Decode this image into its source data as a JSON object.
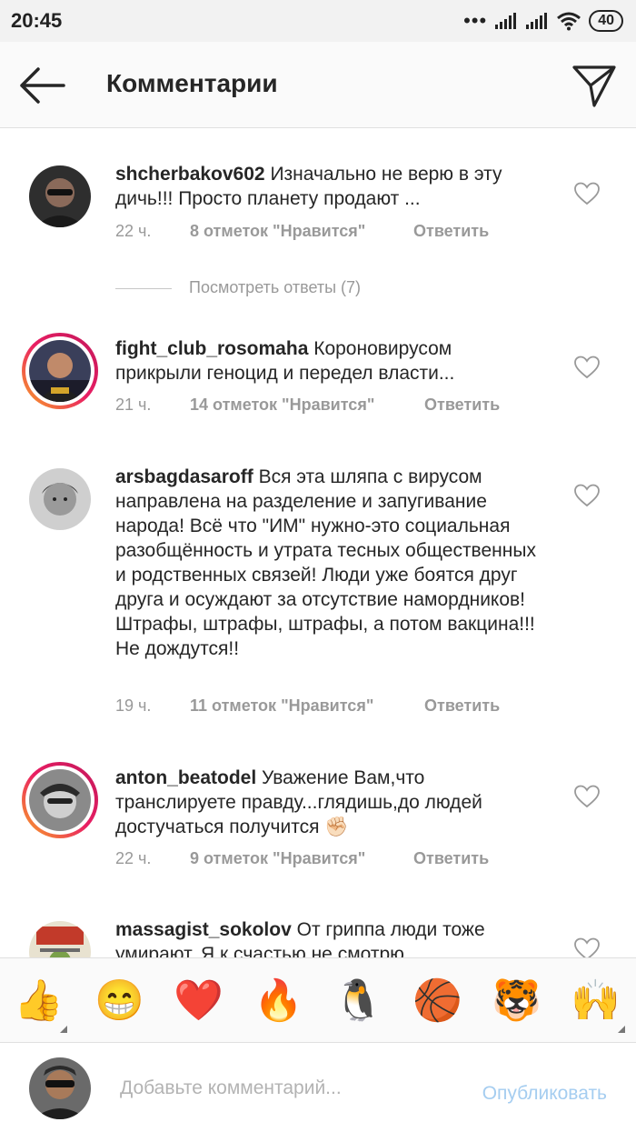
{
  "status_bar": {
    "time": "20:45",
    "battery": "40"
  },
  "header": {
    "title": "Комментарии"
  },
  "comments": [
    {
      "username": "shcherbakov602",
      "text": "Изначально не верю в эту дичь!!! Просто планету продают ...",
      "time": "22 ч.",
      "likes": "8 отметок \"Нравится\"",
      "reply": "Ответить",
      "view_replies": "Посмотреть ответы (7)"
    },
    {
      "username": "fight_club_rosomaha",
      "text": "Короновирусом прикрыли геноцид и передел власти...",
      "time": "21 ч.",
      "likes": "14 отметок \"Нравится\"",
      "reply": "Ответить"
    },
    {
      "username": "arsbagdasaroff",
      "text": "Вся эта шляпа с вирусом направлена на разделение и запугивание народа! Всё что \"ИМ\" нужно-это социальная разобщённость и утрата тесных общественных и родственных связей! Люди уже боятся друг друга и осуждают за отсутствие намордников! Штрафы, штрафы, штрафы, а потом вакцина!!! Не дождутся!!",
      "time": "19 ч.",
      "likes": "11 отметок \"Нравится\"",
      "reply": "Ответить"
    },
    {
      "username": "anton_beatodel",
      "text": "Уважение Вам,что транслируете правду...глядишь,до людей достучаться получится ✊🏻",
      "time": "22 ч.",
      "likes": "9 отметок \"Нравится\"",
      "reply": "Ответить"
    },
    {
      "username": "massagist_sokolov",
      "text": "От гриппа люди тоже умирают. Я к счастью не смотрю"
    }
  ],
  "emoji_bar": [
    "👍",
    "😁",
    "❤️",
    "🔥",
    "🐧",
    "🏀",
    "🐯",
    "🙌"
  ],
  "composer": {
    "placeholder": "Добавьте комментарий...",
    "publish": "Опубликовать"
  },
  "colors": {
    "accent_disabled": "#a5cdf0",
    "meta_gray": "#999999",
    "ring_gradient": [
      "#f9a825",
      "#e91e63",
      "#c2185b"
    ]
  }
}
